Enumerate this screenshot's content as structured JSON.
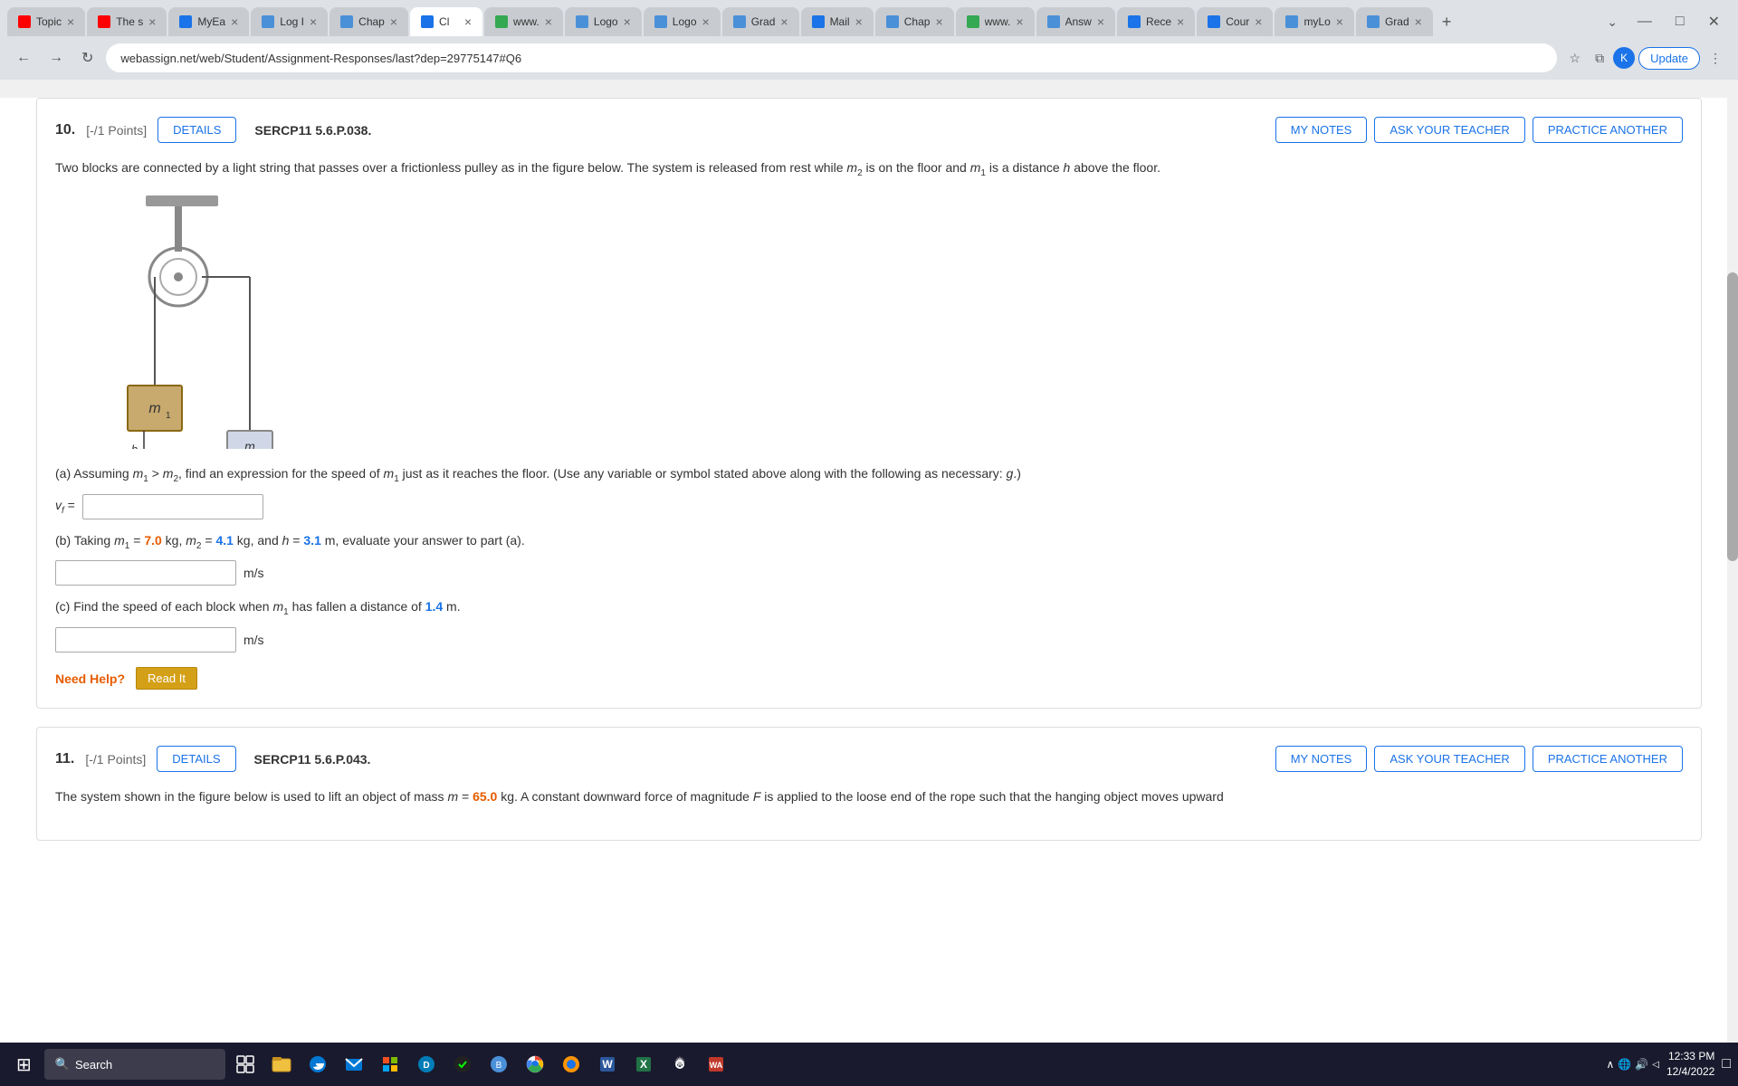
{
  "browser": {
    "tabs": [
      {
        "label": "Topic",
        "favicon_type": "youtube",
        "active": false
      },
      {
        "label": "The s",
        "favicon_type": "youtube",
        "active": false
      },
      {
        "label": "MyEa",
        "favicon_type": "myea",
        "active": false
      },
      {
        "label": "Log I",
        "favicon_type": "chap",
        "active": false
      },
      {
        "label": "Chap",
        "favicon_type": "chap",
        "active": false
      },
      {
        "label": "Cl",
        "favicon_type": "ci",
        "active": true
      },
      {
        "label": "www.",
        "favicon_type": "www",
        "active": false
      },
      {
        "label": "Logo",
        "favicon_type": "chap",
        "active": false
      },
      {
        "label": "Logo",
        "favicon_type": "chap",
        "active": false
      },
      {
        "label": "Grad",
        "favicon_type": "chap",
        "active": false
      },
      {
        "label": "Mail",
        "favicon_type": "myea",
        "active": false
      },
      {
        "label": "Chap",
        "favicon_type": "chap",
        "active": false
      },
      {
        "label": "www.",
        "favicon_type": "www",
        "active": false
      },
      {
        "label": "Answ",
        "favicon_type": "chap",
        "active": false
      },
      {
        "label": "Rece",
        "favicon_type": "myea",
        "active": false
      },
      {
        "label": "Cour",
        "favicon_type": "ci",
        "active": false
      },
      {
        "label": "myLo",
        "favicon_type": "chap",
        "active": false
      },
      {
        "label": "Grad",
        "favicon_type": "chap",
        "active": false
      }
    ],
    "address": "webassign.net/web/Student/Assignment-Responses/last?dep=29775147#Q6",
    "update_label": "Update"
  },
  "question10": {
    "number": "10.",
    "points": "[-/1 Points]",
    "details_label": "DETAILS",
    "code": "SERCP11 5.6.P.038.",
    "my_notes_label": "MY NOTES",
    "ask_teacher_label": "ASK YOUR TEACHER",
    "practice_another_label": "PRACTICE ANOTHER",
    "description": "Two blocks are connected by a light string that passes over a frictionless pulley as in the figure below. The system is released from rest while m₂ is on the floor and m₁ is a distance h above the floor.",
    "sub_a": {
      "text": "(a) Assuming m₁ > m₂, find an expression for the speed of m₁ just as it reaches the floor. (Use any variable or symbol stated above along with the following as necessary: g.)",
      "label": "v_f =",
      "placeholder": ""
    },
    "sub_b": {
      "text_prefix": "(b) Taking m₁ = ",
      "m1_val": "7.0",
      "text_mid": " kg, m₂ = ",
      "m2_val": "4.1",
      "text_mid2": " kg, and h = ",
      "h_val": "3.1",
      "text_suffix": " m, evaluate your answer to part (a).",
      "unit": "m/s"
    },
    "sub_c": {
      "text_prefix": "(c) Find the speed of each block when m₁ has fallen a distance of ",
      "dist_val": "1.4",
      "text_suffix": " m.",
      "unit": "m/s"
    },
    "need_help_label": "Need Help?",
    "read_it_label": "Read It"
  },
  "question11": {
    "number": "11.",
    "points": "[-/1 Points]",
    "details_label": "DETAILS",
    "code": "SERCP11 5.6.P.043.",
    "my_notes_label": "MY NOTES",
    "ask_teacher_label": "ASK YOUR TEACHER",
    "practice_another_label": "PRACTICE ANOTHER",
    "description": "The system shown in the figure below is used to lift an object of mass m = 65.0 kg. A constant downward force of magnitude F is applied to the loose end of the rope such that the hanging object moves upward"
  },
  "taskbar": {
    "search_placeholder": "Search",
    "time": "12:33 PM",
    "date": "12/4/2022"
  }
}
